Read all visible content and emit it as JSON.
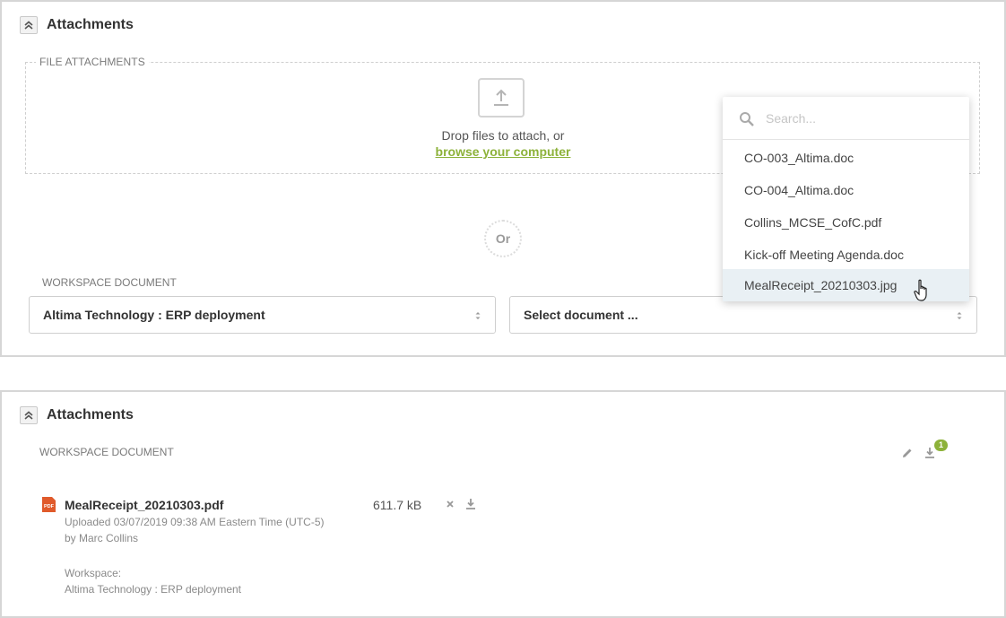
{
  "panel1": {
    "title": "Attachments",
    "file_attachments_label": "FILE ATTACHMENTS",
    "drop_text": "Drop files to attach, or",
    "browse_link": "browse your computer",
    "or_text": "Or",
    "workspace_document_label": "WORKSPACE DOCUMENT",
    "workspace_select_value": "Altima Technology : ERP deployment",
    "document_select_value": "Select document ...",
    "dropdown": {
      "search_placeholder": "Search...",
      "items": [
        "CO-003_Altima.doc",
        "CO-004_Altima.doc",
        "Collins_MCSE_CofC.pdf",
        "Kick-off Meeting Agenda.doc",
        "MealReceipt_20210303.jpg"
      ],
      "hovered_index": 4
    }
  },
  "panel2": {
    "title": "Attachments",
    "workspace_document_label": "WORKSPACE DOCUMENT",
    "download_badge_count": "1",
    "file": {
      "name": "MealReceipt_20210303.pdf",
      "size": "611.7 kB",
      "uploaded": "Uploaded 03/07/2019 09:38 AM Eastern Time (UTC-5)",
      "by": "by Marc Collins",
      "workspace_label": "Workspace:",
      "workspace_value": "Altima Technology : ERP deployment",
      "icon_text": "PDF"
    }
  },
  "colors": {
    "accent_green": "#8db23a",
    "pdf_red": "#e05a2b",
    "hover_row": "#e9f0f4"
  }
}
